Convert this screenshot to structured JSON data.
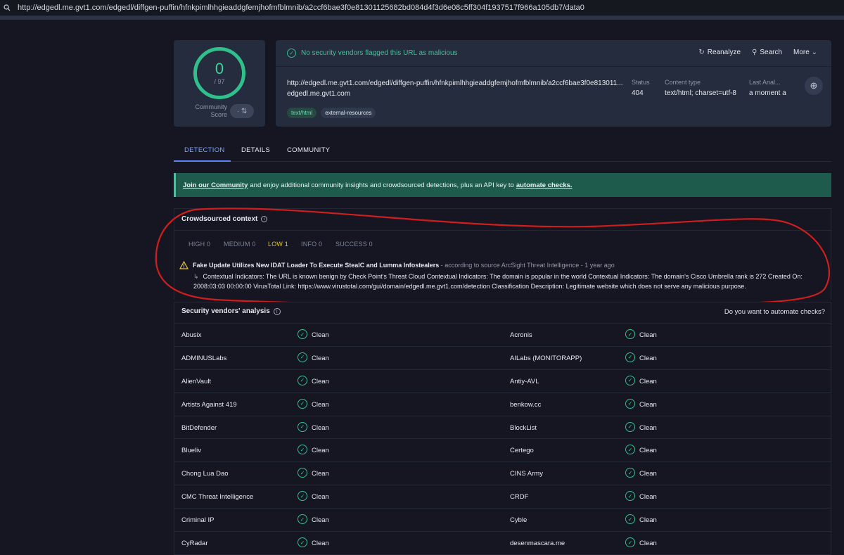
{
  "address_bar": {
    "url": "http://edgedl.me.gvt1.com/edgedl/diffgen-puffin/hfnkpimlhhgieaddgfemjhofmfblmnib/a2ccf6bae3f0e81301125682bd084d4f3d6e08c5ff304f1937517f966a105db7/data0"
  },
  "score": {
    "value": "0",
    "total": "/ 97",
    "community_label": "Community Score"
  },
  "banner": {
    "message": "No security vendors flagged this URL as malicious"
  },
  "actions": {
    "reanalyze": "Reanalyze",
    "search": "Search",
    "more": "More"
  },
  "details": {
    "url": "http://edgedl.me.gvt1.com/edgedl/diffgen-puffin/hfnkpimlhhgieaddgfemjhofmfblmnib/a2ccf6bae3f0e813011...",
    "domain": "edgedl.me.gvt1.com",
    "tags": [
      "text/html",
      "external-resources"
    ],
    "status_label": "Status",
    "status_value": "404",
    "content_type_label": "Content type",
    "content_type_value": "text/html; charset=utf-8",
    "last_analysis_label": "Last Anal...",
    "last_analysis_value": "a moment a"
  },
  "tabs": [
    "DETECTION",
    "DETAILS",
    "COMMUNITY"
  ],
  "join": {
    "link1": "Join our Community",
    "middle": "and enjoy additional community insights and crowdsourced detections, plus an API key to",
    "link2": "automate checks."
  },
  "crowdsourced": {
    "title": "Crowdsourced context",
    "severities": [
      "HIGH 0",
      "MEDIUM 0",
      "LOW 1",
      "INFO 0",
      "SUCCESS 0"
    ],
    "alert_title": "Fake Update Utilizes New IDAT Loader To Execute StealC and Lumma Infostealers",
    "alert_source": " - according to source ArcSight Threat Intelligence - 1 year ago",
    "alert_desc": "Contextual Indicators: The URL is known benign by Check Point's Threat Cloud Contextual Indicators: The domain is popular in the world Contextual Indicators: The domain's Cisco Umbrella rank is 272 Created On: 2008:03:03 00:00:00 VirusTotal Link: https://www.virustotal.com/gui/domain/edgedl.me.gvt1.com/detection Classification Description: Legitimate website which does not serve any malicious purpose."
  },
  "vendors": {
    "title": "Security vendors' analysis",
    "automate": "Do you want to automate checks?",
    "rows": [
      {
        "left": "Abusix",
        "left_result": "Clean",
        "right": "Acronis",
        "right_result": "Clean"
      },
      {
        "left": "ADMINUSLabs",
        "left_result": "Clean",
        "right": "AILabs (MONITORAPP)",
        "right_result": "Clean"
      },
      {
        "left": "AlienVault",
        "left_result": "Clean",
        "right": "Antiy-AVL",
        "right_result": "Clean"
      },
      {
        "left": "Artists Against 419",
        "left_result": "Clean",
        "right": "benkow.cc",
        "right_result": "Clean"
      },
      {
        "left": "BitDefender",
        "left_result": "Clean",
        "right": "BlockList",
        "right_result": "Clean"
      },
      {
        "left": "Blueliv",
        "left_result": "Clean",
        "right": "Certego",
        "right_result": "Clean"
      },
      {
        "left": "Chong Lua Dao",
        "left_result": "Clean",
        "right": "CINS Army",
        "right_result": "Clean"
      },
      {
        "left": "CMC Threat Intelligence",
        "left_result": "Clean",
        "right": "CRDF",
        "right_result": "Clean"
      },
      {
        "left": "Criminal IP",
        "left_result": "Clean",
        "right": "Cyble",
        "right_result": "Clean"
      },
      {
        "left": "CyRadar",
        "left_result": "Clean",
        "right": "desenmascara.me",
        "right_result": "Clean"
      }
    ]
  }
}
